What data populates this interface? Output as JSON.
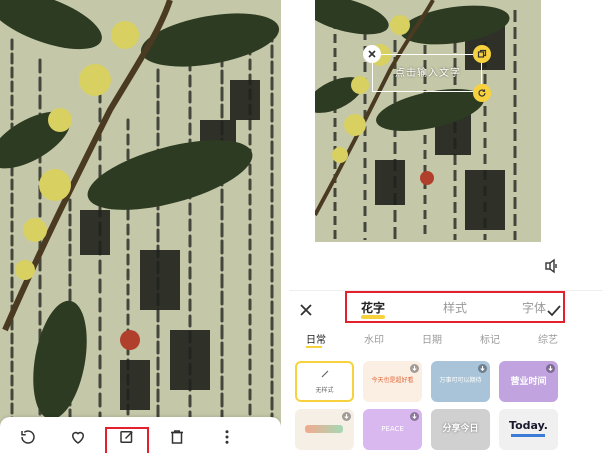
{
  "right": {
    "preview": {
      "text_placeholder": "点击输入文字"
    },
    "panel": {
      "tabs": [
        {
          "label": "花字",
          "active": true
        },
        {
          "label": "样式",
          "active": false
        },
        {
          "label": "字体",
          "active": false
        }
      ],
      "categories": [
        {
          "label": "日常",
          "active": true
        },
        {
          "label": "水印",
          "active": false
        },
        {
          "label": "日期",
          "active": false
        },
        {
          "label": "标记",
          "active": false
        },
        {
          "label": "综艺",
          "active": false
        }
      ],
      "tiles_row1": [
        {
          "label": "无样式",
          "selected": true
        },
        {
          "label": "今天也是超好看",
          "download": true
        },
        {
          "label": "万事可可以期待",
          "download": true
        },
        {
          "label": "营业时间",
          "download": true
        }
      ],
      "tiles_row2": [
        {
          "label": "",
          "download": true
        },
        {
          "label": "PEACE",
          "download": true
        },
        {
          "label": "分享今日",
          "download": false
        },
        {
          "label": "Today.",
          "download": false
        }
      ]
    }
  },
  "colors": {
    "accent_yellow": "#f7d23e",
    "highlight_red": "#e5202e"
  },
  "icons": [
    "replay-icon",
    "heart-icon",
    "edit-icon",
    "delete-icon",
    "more-icon",
    "close-icon",
    "copy-icon",
    "rotate-icon",
    "audio-icon",
    "check-icon",
    "download-icon"
  ]
}
